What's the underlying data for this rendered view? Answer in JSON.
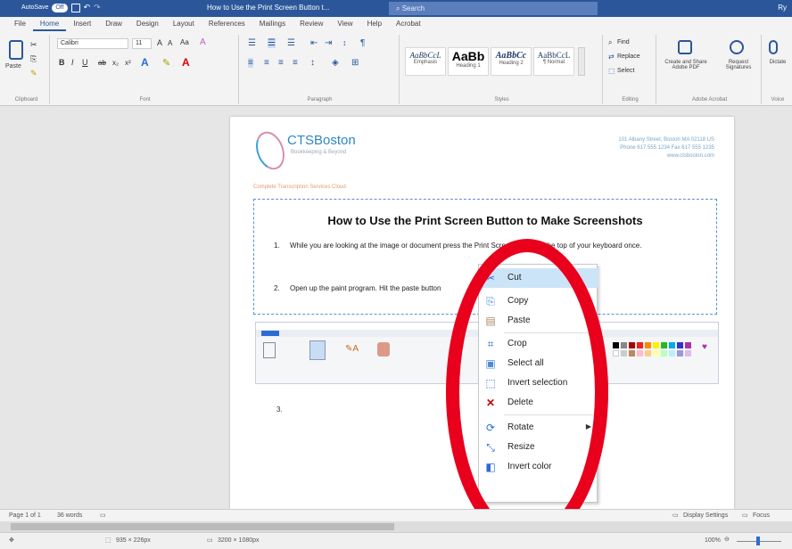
{
  "titlebar": {
    "autosave": "AutoSave",
    "autosave_state": "Off",
    "doc_title": "How to Use the Print Screen Button t...",
    "search": "Search",
    "user": "Ry"
  },
  "tabs": [
    "File",
    "Home",
    "Insert",
    "Draw",
    "Design",
    "Layout",
    "References",
    "Mailings",
    "Review",
    "View",
    "Help",
    "Acrobat"
  ],
  "ribbon": {
    "font_name": "Calibri",
    "font_size": "11",
    "paste": "Paste",
    "groups": {
      "clipboard": "Clipboard",
      "font": "Font",
      "paragraph": "Paragraph",
      "styles": "Styles",
      "editing": "Editing",
      "adobe": "Adobe Acrobat",
      "voice": "Voice"
    },
    "styles": [
      {
        "sample": "AaBbCcL",
        "name": "Emphasis"
      },
      {
        "sample": "AaBb",
        "name": "Heading 1"
      },
      {
        "sample": "AaBbCc",
        "name": "Heading 2"
      },
      {
        "sample": "AaBbCcL",
        "name": "¶ Normal"
      }
    ],
    "editing": {
      "find": "Find",
      "replace": "Replace",
      "select": "Select"
    },
    "adobe": {
      "create": "Create and Share Adobe PDF",
      "request": "Request Signatures"
    },
    "voice": "Dictate"
  },
  "document": {
    "logo_name": "CTSBoston",
    "logo_sub": "Bookkeeping & Beyond",
    "address": "101 Albany Street, Boston MA 02118 US",
    "phone": "Phone 617 555 1234 Fax 617 555 1235",
    "web": "www.ctsboston.com",
    "brand_line": "Complete Transcription Services Cloud",
    "title": "How to Use the Print Screen Button to Make Screenshots",
    "step1_num": "1.",
    "step1": "While you are looking at the image or document press the Print Screen button at the top of your keyboard once.",
    "step2_num": "2.",
    "step2": "Open up the paint program.  Hit the paste button",
    "step3_num": "3."
  },
  "context_menu": [
    {
      "icon": "scissors-icon",
      "glyph": "✂",
      "label": "Cut",
      "highlight": true
    },
    {
      "icon": "copy-icon",
      "glyph": "⎘",
      "label": "Copy"
    },
    {
      "icon": "paste-icon",
      "glyph": "▤",
      "label": "Paste"
    },
    {
      "icon": "crop-icon",
      "glyph": "⌗",
      "label": "Crop"
    },
    {
      "icon": "select-all-icon",
      "glyph": "▣",
      "label": "Select all"
    },
    {
      "icon": "invert-selection-icon",
      "glyph": "⬚",
      "label": "Invert selection"
    },
    {
      "icon": "delete-icon",
      "glyph": "✕",
      "label": "Delete"
    },
    {
      "icon": "rotate-icon",
      "glyph": "⟳",
      "label": "Rotate",
      "submenu": true
    },
    {
      "icon": "resize-icon",
      "glyph": "⤡",
      "label": "Resize"
    },
    {
      "icon": "invert-color-icon",
      "glyph": "◧",
      "label": "Invert color"
    }
  ],
  "statusbar": {
    "page": "Page 1 of 1",
    "words": "36 words",
    "display": "Display Settings",
    "focus": "Focus"
  },
  "paint_status": {
    "selection": "935 × 226px",
    "size": "3200 × 1080px",
    "zoom": "100%"
  },
  "colors": {
    "word_blue": "#2b579a",
    "highlight_red": "#e8001c",
    "menu_highlight": "#cce4f7"
  }
}
